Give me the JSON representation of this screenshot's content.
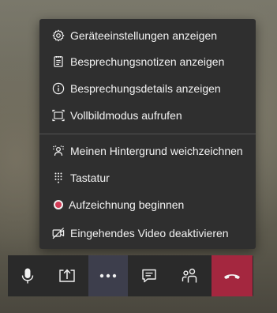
{
  "menu": {
    "items": [
      {
        "label": "Geräteeinstellungen anzeigen",
        "icon": "gear-icon"
      },
      {
        "label": "Besprechungsnotizen anzeigen",
        "icon": "notes-icon"
      },
      {
        "label": "Besprechungsdetails anzeigen",
        "icon": "info-icon"
      },
      {
        "label": "Vollbildmodus aufrufen",
        "icon": "fullscreen-icon"
      },
      {
        "label": "Meinen Hintergrund weichzeichnen",
        "icon": "blur-background-icon"
      },
      {
        "label": "Tastatur",
        "icon": "keypad-icon"
      },
      {
        "label": "Aufzeichnung beginnen",
        "icon": "record-icon"
      },
      {
        "label": "Eingehendes Video deaktivieren",
        "icon": "video-off-icon"
      }
    ]
  },
  "toolbar": {
    "buttons": [
      {
        "name": "microphone",
        "icon": "microphone-icon"
      },
      {
        "name": "share",
        "icon": "share-screen-icon"
      },
      {
        "name": "more-options",
        "icon": "more-options-icon",
        "active": true
      },
      {
        "name": "chat",
        "icon": "chat-icon"
      },
      {
        "name": "participants",
        "icon": "participants-icon"
      },
      {
        "name": "hang-up",
        "icon": "hang-up-icon"
      }
    ]
  },
  "colors": {
    "menu_bg": "#2f2f2f",
    "toolbar_bg": "#2a2a2a",
    "active_button": "#3d3e4c",
    "hangup": "#a4273f",
    "record_dot": "#d13b55",
    "text": "#f2f2f2"
  }
}
